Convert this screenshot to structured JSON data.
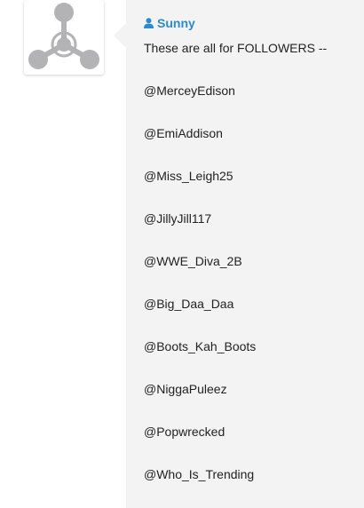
{
  "post": {
    "author": "Sunny",
    "intro": "These are all for FOLLOWERS --",
    "handles": [
      "@MerceyEdison",
      "@EmiAddison",
      "@Miss_Leigh25",
      "@JillyJill117",
      "@WWE_Diva_2B",
      "@Big_Daa_Daa",
      "@Boots_Kah_Boots",
      "@NiggaPuleez",
      "@Popwrecked",
      "@Who_Is_Trending"
    ]
  },
  "colors": {
    "author_link": "#2a8ad4",
    "panel_bg": "#f3f3f3",
    "avatar_gray": "#b3b3b5",
    "text": "#222222"
  },
  "icons": {
    "avatar": "default-avatar-icon",
    "author": "user-icon"
  }
}
